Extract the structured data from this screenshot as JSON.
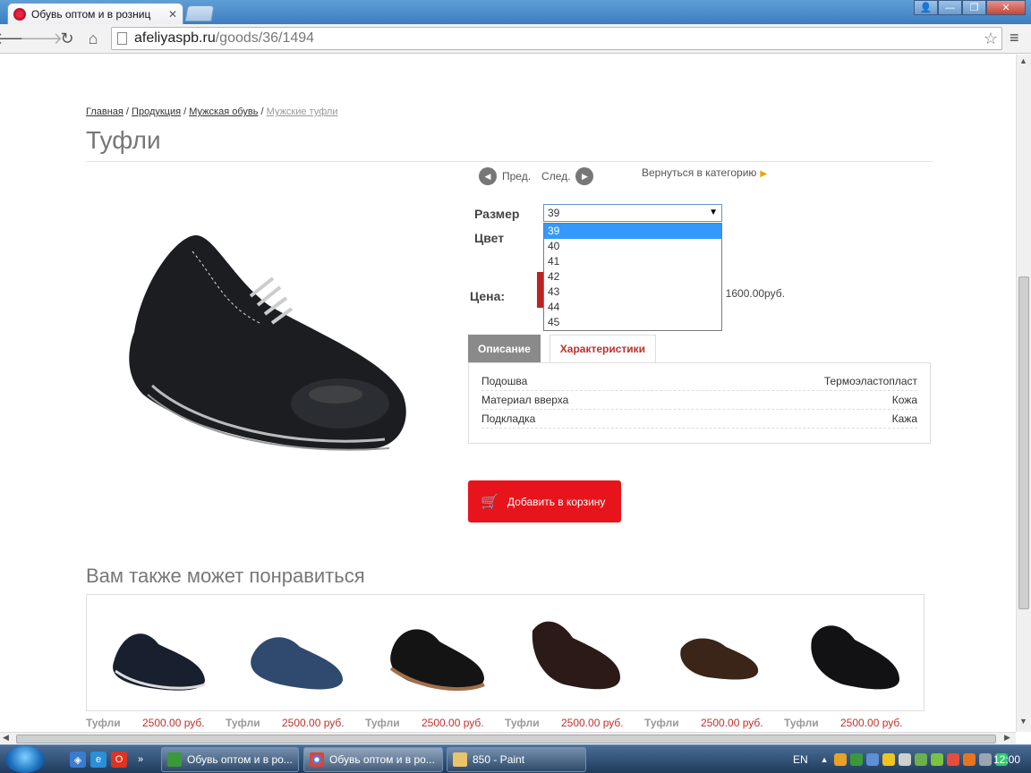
{
  "browser": {
    "tab_title": "Обувь оптом и в розниц",
    "url_host": "afeliyaspb.ru",
    "url_path": "/goods/36/1494"
  },
  "breadcrumb": {
    "items": [
      "Главная",
      "Продукция",
      "Мужская обувь"
    ],
    "separator": " / ",
    "current": "Мужские туфли"
  },
  "product": {
    "title": "Туфли",
    "prev_label": "Пред.",
    "next_label": "След.",
    "back_to_category": "Вернуться в категорию",
    "size_label": "Размер",
    "color_label": "Цвет",
    "price_label": "Цена:",
    "price_text": ": 1600.00руб.",
    "selected_size": "39",
    "size_options": [
      "39",
      "40",
      "41",
      "42",
      "43",
      "44",
      "45"
    ],
    "tab_description": "Описание",
    "tab_characteristics": "Характеристики",
    "characteristics": [
      {
        "name": "Подошва",
        "value": "Термоэластопласт"
      },
      {
        "name": "Материал вверха",
        "value": "Кожа"
      },
      {
        "name": "Подкладка",
        "value": "Кажа"
      }
    ],
    "add_to_cart": "Добавить в корзину"
  },
  "also_like": {
    "title": "Вам также может понравиться",
    "items": [
      {
        "name": "Туфли",
        "price": "2500.00 руб."
      },
      {
        "name": "Туфли",
        "price": "2500.00 руб."
      },
      {
        "name": "Туфли",
        "price": "2500.00 руб."
      },
      {
        "name": "Туфли",
        "price": "2500.00 руб."
      },
      {
        "name": "Туфли",
        "price": "2500.00 руб."
      },
      {
        "name": "Туфли",
        "price": "2500.00 руб."
      }
    ]
  },
  "taskbar": {
    "tasks": [
      "Обувь оптом и в ро...",
      "Обувь оптом и в ро...",
      "850 - Paint"
    ],
    "lang": "EN",
    "clock": "12:00"
  },
  "colors": {
    "accent_red": "#e8141c",
    "tab_active_text": "#c0302b",
    "selection_blue": "#3399ff"
  }
}
